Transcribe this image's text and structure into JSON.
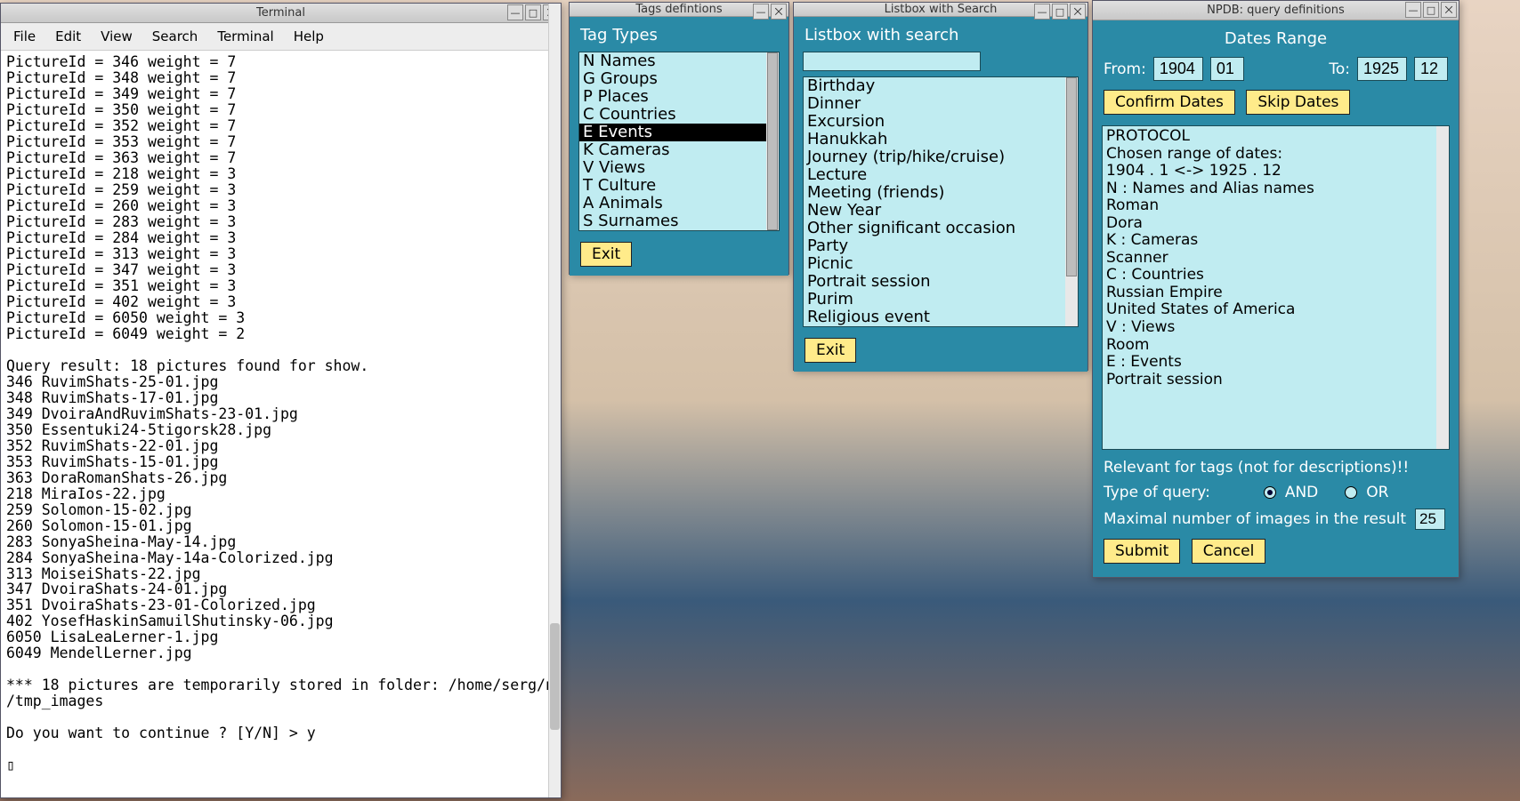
{
  "terminal": {
    "title": "Terminal",
    "menu": [
      "File",
      "Edit",
      "View",
      "Search",
      "Terminal",
      "Help"
    ],
    "text": "PictureId = 346 weight = 7\nPictureId = 348 weight = 7\nPictureId = 349 weight = 7\nPictureId = 350 weight = 7\nPictureId = 352 weight = 7\nPictureId = 353 weight = 7\nPictureId = 363 weight = 7\nPictureId = 218 weight = 3\nPictureId = 259 weight = 3\nPictureId = 260 weight = 3\nPictureId = 283 weight = 3\nPictureId = 284 weight = 3\nPictureId = 313 weight = 3\nPictureId = 347 weight = 3\nPictureId = 351 weight = 3\nPictureId = 402 weight = 3\nPictureId = 6050 weight = 3\nPictureId = 6049 weight = 2\n\nQuery result: 18 pictures found for show.\n346 RuvimShats-25-01.jpg\n348 RuvimShats-17-01.jpg\n349 DvoiraAndRuvimShats-23-01.jpg\n350 Essentuki24-5tigorsk28.jpg\n352 RuvimShats-22-01.jpg\n353 RuvimShats-15-01.jpg\n363 DoraRomanShats-26.jpg\n218 MiraIos-22.jpg\n259 Solomon-15-02.jpg\n260 Solomon-15-01.jpg\n283 SonyaSheina-May-14.jpg\n284 SonyaSheina-May-14a-Colorized.jpg\n313 MoiseiShats-22.jpg\n347 DvoiraShats-24-01.jpg\n351 DvoiraShats-23-01-Colorized.jpg\n402 YosefHaskinSamuilShutinsky-06.jpg\n6050 LisaLeaLerner-1.jpg\n6049 MendelLerner.jpg\n\n*** 18 pictures are temporarily stored in folder: /home/serg/npdb/db\n/tmp_images\n\nDo you want to continue ? [Y/N] > y\n\n▯"
  },
  "tags": {
    "title": "Tags defintions",
    "header": "Tag Types",
    "items": [
      "N Names",
      "G Groups",
      "P Places",
      "C Countries",
      "E Events",
      "K Cameras",
      "V Views",
      "T Culture",
      "A Animals",
      "S Surnames"
    ],
    "selected": 4,
    "exit": "Exit"
  },
  "listbox": {
    "title": "Listbox with Search",
    "header": "Listbox with search",
    "search_value": "",
    "items": [
      "Birthday",
      "Dinner",
      "Excursion",
      "Hanukkah",
      "Journey (trip/hike/cruise)",
      "Lecture",
      "Meeting (friends)",
      "New Year",
      "Other significant occasion",
      "Party",
      "Picnic",
      "Portrait session",
      "Purim",
      "Religious event"
    ],
    "exit": "Exit"
  },
  "query": {
    "title": "NPDB: query definitions",
    "header": "Dates Range",
    "from_label": "From:",
    "to_label": "To:",
    "from_year": "1904",
    "from_month": "01",
    "to_year": "1925",
    "to_month": "12",
    "confirm": "Confirm Dates",
    "skip": "Skip Dates",
    "protocol_lines": [
      "PROTOCOL",
      "Chosen range of dates:",
      "1904 . 1  <->  1925 . 12",
      "N : Names and Alias names",
      "Roman",
      "Dora",
      "K : Cameras",
      "Scanner",
      "C : Countries",
      "Russian Empire",
      "United States of America",
      "V : Views",
      "Room",
      "E : Events",
      "Portrait session"
    ],
    "relevant_note": "Relevant for tags (not for descriptions)!!",
    "type_label": "Type of query:",
    "and": "AND",
    "or": "OR",
    "and_selected": true,
    "max_label": "Maximal number of images in the result",
    "max_value": "25",
    "submit": "Submit",
    "cancel": "Cancel"
  }
}
